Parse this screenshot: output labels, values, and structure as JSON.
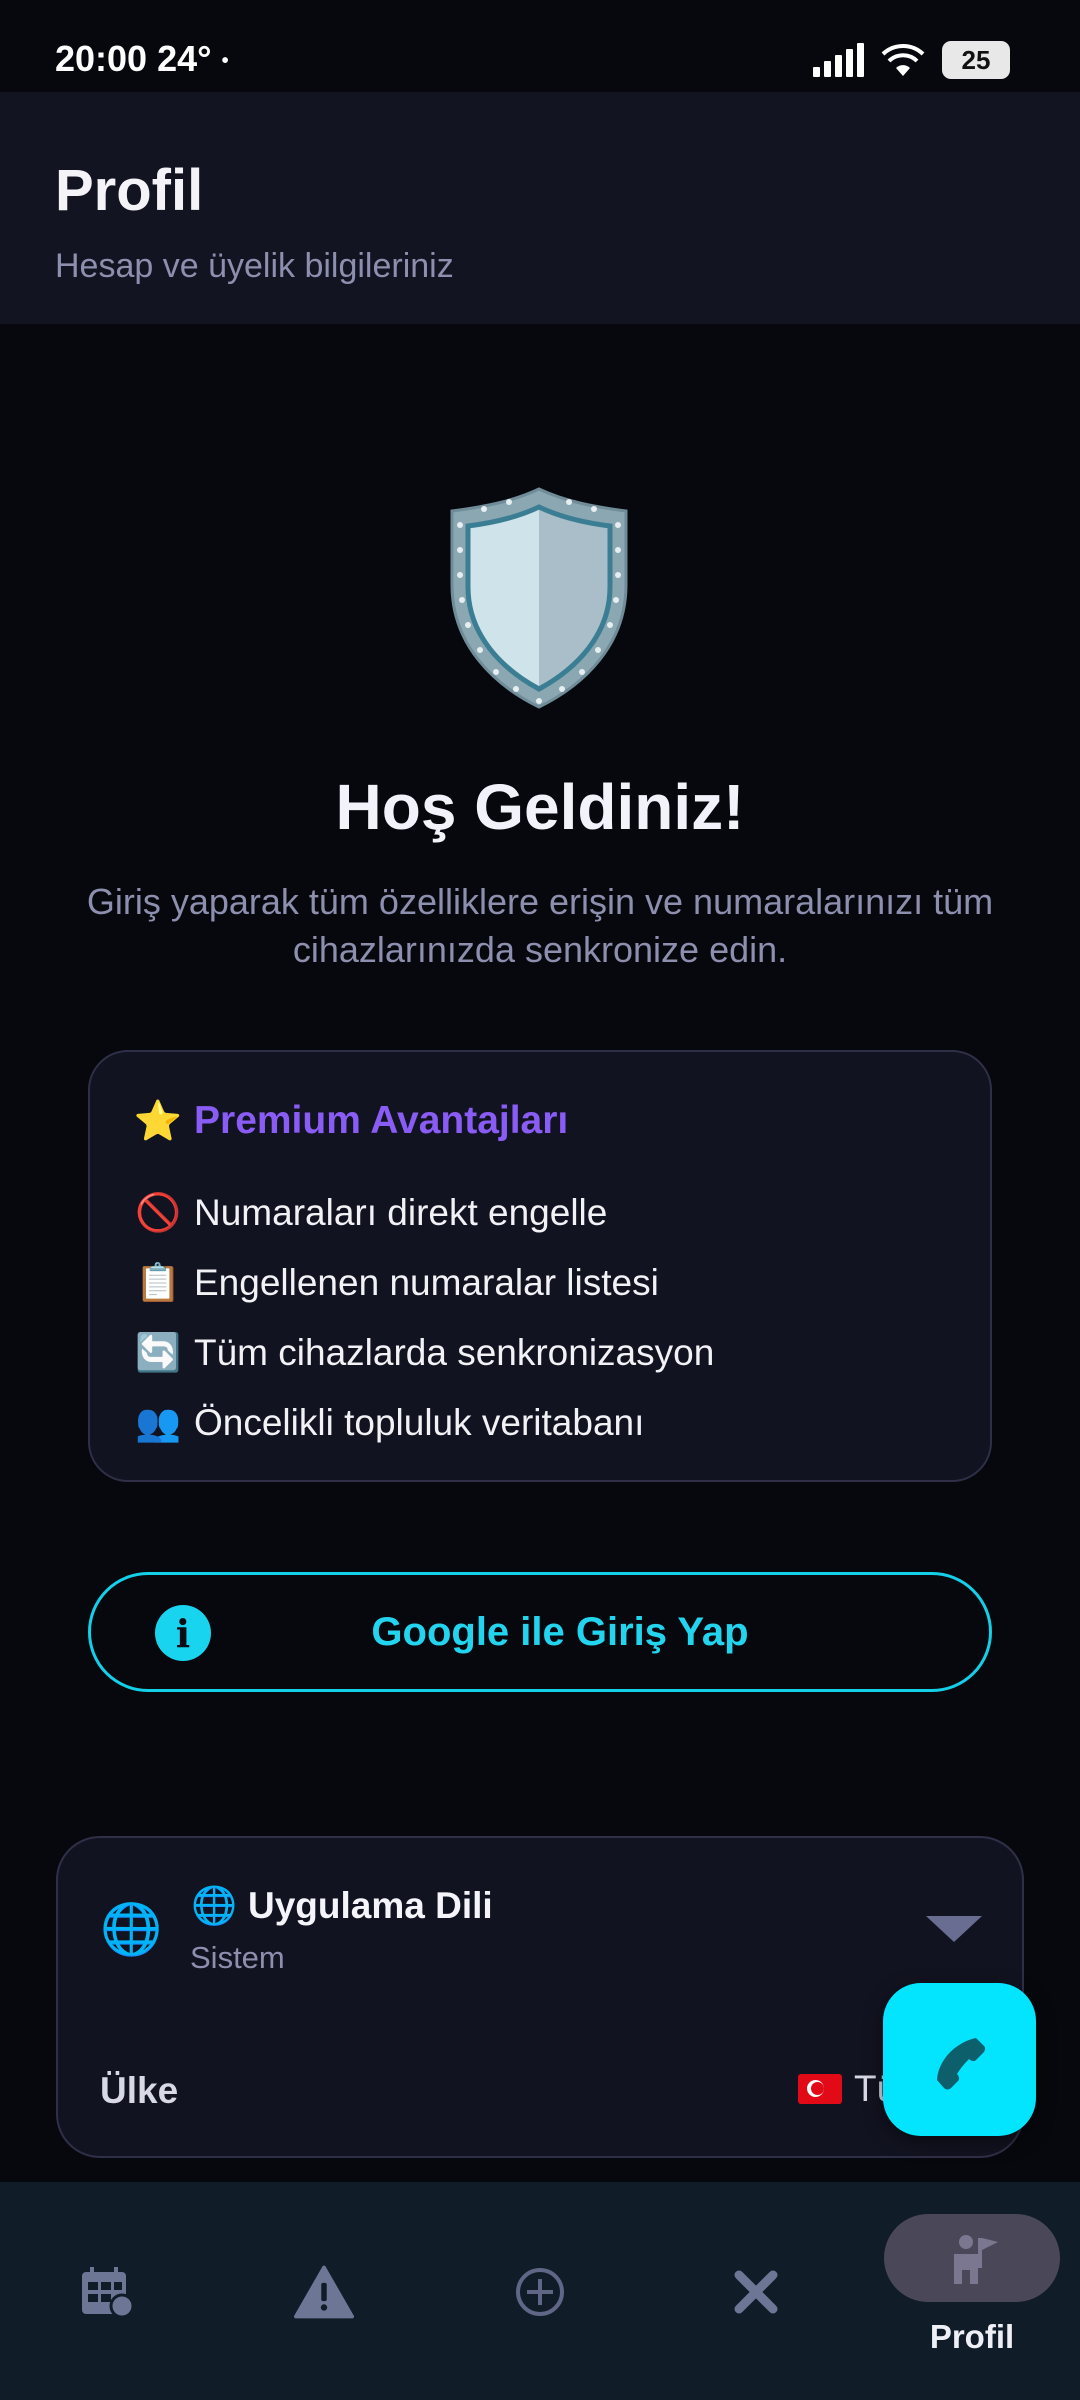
{
  "status_bar": {
    "time": "20:00",
    "temperature": "24°",
    "dot": "•",
    "battery": "25"
  },
  "header": {
    "title": "Profil",
    "subtitle": "Hesap ve üyelik bilgileriniz"
  },
  "hero": {
    "icon": "shield-icon",
    "title": "Hoş Geldiniz!",
    "description": "Giriş yaparak tüm özelliklere erişin ve numaralarınızı tüm cihazlarınızda senkronize edin."
  },
  "premium": {
    "title_emoji": "⭐",
    "title": "Premium Avantajları",
    "items": [
      {
        "emoji": "🚫",
        "label": "Numaraları direkt engelle"
      },
      {
        "emoji": "📋",
        "label": "Engellenen numaralar listesi"
      },
      {
        "emoji": "🔄",
        "label": "Tüm cihazlarda senkronizasyon"
      },
      {
        "emoji": "👥",
        "label": "Öncelikli topluluk veritabanı"
      }
    ]
  },
  "login": {
    "button_label": "Google ile Giriş Yap",
    "icon_glyph": "i"
  },
  "settings": {
    "language_icon": "🌐",
    "language_title_emoji": "🌐",
    "language_title": "Uygulama Dili",
    "language_value": "Sistem",
    "country_label": "Ülke",
    "country_value": "Tü"
  },
  "bottom_nav": {
    "items": [
      {
        "icon": "calendar-grid-icon",
        "label": ""
      },
      {
        "icon": "warning-icon",
        "label": ""
      },
      {
        "icon": "add-circle-icon",
        "label": ""
      },
      {
        "icon": "close-x-icon",
        "label": ""
      },
      {
        "icon": "profile-icon",
        "label": "Profil"
      }
    ],
    "active_index": 4
  },
  "colors": {
    "background": "#07080d",
    "header_bg": "#131421",
    "accent_cyan": "#03e4ff",
    "premium_purple": "#8a5cf6",
    "nav_bg": "#111c29"
  }
}
